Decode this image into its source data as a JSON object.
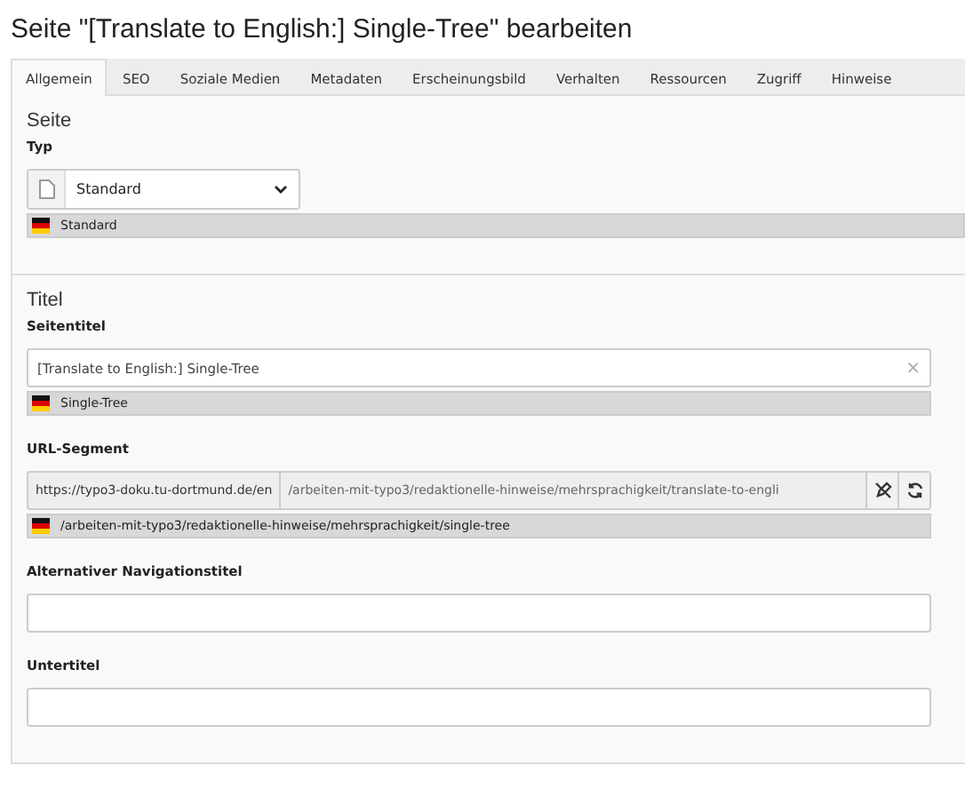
{
  "heading": "Seite \"[Translate to English:] Single-Tree\" bearbeiten",
  "tabs": [
    {
      "label": "Allgemein",
      "selected": true
    },
    {
      "label": "SEO",
      "selected": false
    },
    {
      "label": "Soziale Medien",
      "selected": false
    },
    {
      "label": "Metadaten",
      "selected": false
    },
    {
      "label": "Erscheinungsbild",
      "selected": false
    },
    {
      "label": "Verhalten",
      "selected": false
    },
    {
      "label": "Ressourcen",
      "selected": false
    },
    {
      "label": "Zugriff",
      "selected": false
    },
    {
      "label": "Hinweise",
      "selected": false
    }
  ],
  "sections": [
    {
      "title": "Seite",
      "fields": [
        {
          "kind": "select",
          "label": "Typ",
          "value": "Standard",
          "original": "Standard"
        }
      ]
    },
    {
      "title": "Titel",
      "fields": [
        {
          "kind": "text",
          "label": "Seitentitel",
          "value": "[Translate to English:] Single-Tree",
          "clear": "×",
          "original": "Single-Tree"
        },
        {
          "kind": "url",
          "label": "URL-Segment",
          "prefix": "https://typo3-doku.tu-dortmund.de/en",
          "value": "/arbeiten-mit-typo3/redaktionelle-hinweise/mehrsprachigkeit/translate-to-engli",
          "original": "/arbeiten-mit-typo3/redaktionelle-hinweise/mehrsprachigkeit/single-tree"
        },
        {
          "kind": "text",
          "label": "Alternativer Navigationstitel"
        },
        {
          "kind": "text",
          "label": "Untertitel"
        }
      ]
    }
  ]
}
